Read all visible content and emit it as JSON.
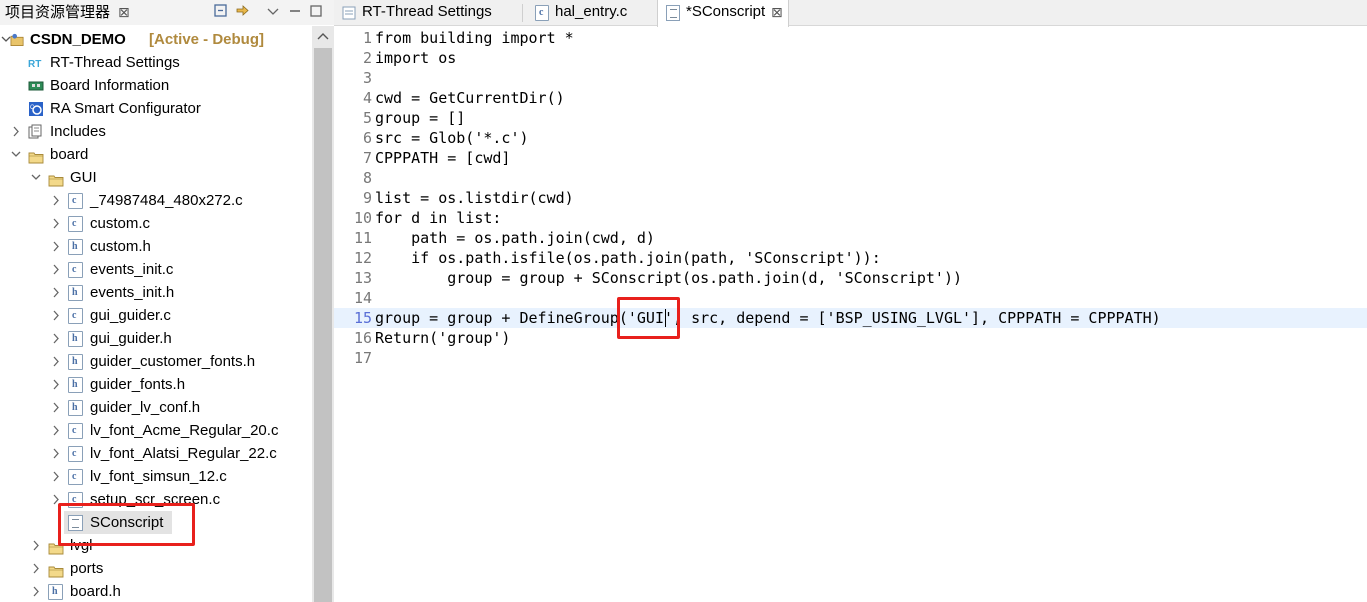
{
  "explorer": {
    "title": "项目资源管理器",
    "close_glyph": "⊠",
    "root": {
      "name": "CSDN_DEMO",
      "status": "[Active - Debug]"
    },
    "items": [
      {
        "label": "RT-Thread Settings",
        "icon": "rt-thread-icon"
      },
      {
        "label": "Board Information",
        "icon": "board-info-icon"
      },
      {
        "label": "RA Smart Configurator",
        "icon": "ra-configurator-icon"
      },
      {
        "label": "Includes",
        "icon": "includes-icon"
      },
      {
        "label": "board",
        "icon": "folder-icon"
      },
      {
        "label": "GUI",
        "icon": "folder-icon"
      },
      {
        "label": "_74987484_480x272.c",
        "icon": "c-file-icon"
      },
      {
        "label": "custom.c",
        "icon": "c-file-icon"
      },
      {
        "label": "custom.h",
        "icon": "h-file-icon"
      },
      {
        "label": "events_init.c",
        "icon": "c-file-icon"
      },
      {
        "label": "events_init.h",
        "icon": "h-file-icon"
      },
      {
        "label": "gui_guider.c",
        "icon": "c-file-icon"
      },
      {
        "label": "gui_guider.h",
        "icon": "h-file-icon"
      },
      {
        "label": "guider_customer_fonts.h",
        "icon": "h-file-icon"
      },
      {
        "label": "guider_fonts.h",
        "icon": "h-file-icon"
      },
      {
        "label": "guider_lv_conf.h",
        "icon": "h-file-icon"
      },
      {
        "label": "lv_font_Acme_Regular_20.c",
        "icon": "c-file-icon"
      },
      {
        "label": "lv_font_Alatsi_Regular_22.c",
        "icon": "c-file-icon"
      },
      {
        "label": "lv_font_simsun_12.c",
        "icon": "c-file-icon"
      },
      {
        "label": "setup_scr_screen.c",
        "icon": "c-file-icon"
      },
      {
        "label": "SConscript",
        "icon": "text-file-icon"
      },
      {
        "label": "lvgl",
        "icon": "folder-icon"
      },
      {
        "label": "ports",
        "icon": "folder-icon"
      },
      {
        "label": "board.h",
        "icon": "h-file-icon"
      }
    ]
  },
  "tabs": [
    {
      "label": "RT-Thread Settings",
      "icon": "rt-thread-icon"
    },
    {
      "label": "hal_entry.c",
      "icon": "c-file-icon"
    },
    {
      "label": "*SConscript",
      "icon": "text-file-icon",
      "active": true
    }
  ],
  "editor": {
    "current_line": 15,
    "lines": [
      "from building import *",
      "import os",
      "",
      "cwd = GetCurrentDir()",
      "group = []",
      "src = Glob('*.c')",
      "CPPPATH = [cwd]",
      "",
      "list = os.listdir(cwd)",
      "for d in list:",
      "    path = os.path.join(cwd, d)",
      "    if os.path.isfile(os.path.join(path, 'SConscript')):",
      "        group = group + SConscript(os.path.join(d, 'SConscript'))",
      "",
      "group = group + DefineGroup('GUI', src, depend = ['BSP_USING_LVGL'], CPPPATH = CPPPATH)",
      "Return('group')",
      ""
    ],
    "line_numbers": [
      "1",
      "2",
      "3",
      "4",
      "5",
      "6",
      "7",
      "8",
      "9",
      "10",
      "11",
      "12",
      "13",
      "14",
      "15",
      "16",
      "17"
    ]
  },
  "colors": {
    "highlight_box": "#e8201c",
    "current_line_bg": "#e8f2fe",
    "active_status": "#b08a3e"
  }
}
